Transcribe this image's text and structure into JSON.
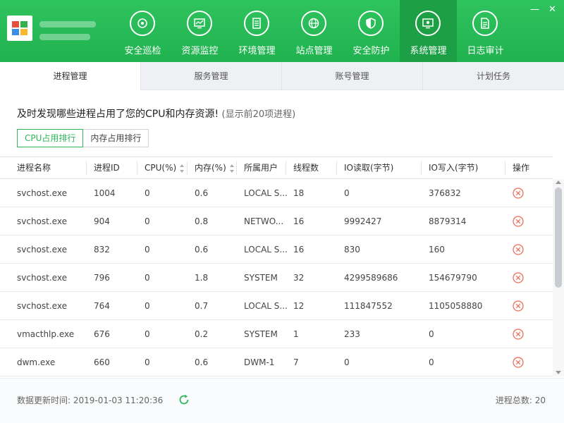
{
  "header": {
    "nav": [
      {
        "label": "安全巡检",
        "icon": "shield-scan-icon"
      },
      {
        "label": "资源监控",
        "icon": "monitor-chart-icon"
      },
      {
        "label": "环境管理",
        "icon": "server-icon"
      },
      {
        "label": "站点管理",
        "icon": "globe-icon"
      },
      {
        "label": "安全防护",
        "icon": "shield-icon"
      },
      {
        "label": "系统管理",
        "icon": "system-monitor-icon"
      },
      {
        "label": "日志审计",
        "icon": "document-icon"
      }
    ],
    "active_nav": "系统管理",
    "minimize": "—",
    "close": "✕"
  },
  "tabs": [
    "进程管理",
    "服务管理",
    "账号管理",
    "计划任务"
  ],
  "active_tab": "进程管理",
  "intro": {
    "main": "及时发现哪些进程占用了您的CPU和内存资源!",
    "note": "(显示前20项进程)"
  },
  "sort_buttons": [
    "CPU占用排行",
    "内存占用排行"
  ],
  "table": {
    "columns": [
      "进程名称",
      "进程ID",
      "CPU(%)",
      "内存(%)",
      "所属用户",
      "线程数",
      "IO读取(字节)",
      "IO写入(字节)",
      "操作"
    ],
    "rows": [
      {
        "name": "svchost.exe",
        "pid": "1004",
        "cpu": "0",
        "mem": "0.6",
        "user": "LOCAL S...",
        "threads": "18",
        "io_read": "0",
        "io_write": "376832"
      },
      {
        "name": "svchost.exe",
        "pid": "904",
        "cpu": "0",
        "mem": "0.8",
        "user": "NETWO...",
        "threads": "16",
        "io_read": "9992427",
        "io_write": "8879314"
      },
      {
        "name": "svchost.exe",
        "pid": "832",
        "cpu": "0",
        "mem": "0.6",
        "user": "LOCAL S...",
        "threads": "16",
        "io_read": "830",
        "io_write": "160"
      },
      {
        "name": "svchost.exe",
        "pid": "796",
        "cpu": "0",
        "mem": "1.8",
        "user": "SYSTEM",
        "threads": "32",
        "io_read": "4299589686",
        "io_write": "154679790"
      },
      {
        "name": "svchost.exe",
        "pid": "764",
        "cpu": "0",
        "mem": "0.7",
        "user": "LOCAL S...",
        "threads": "12",
        "io_read": "111847552",
        "io_write": "1105058880"
      },
      {
        "name": "vmacthlp.exe",
        "pid": "676",
        "cpu": "0",
        "mem": "0.2",
        "user": "SYSTEM",
        "threads": "1",
        "io_read": "233",
        "io_write": "0"
      },
      {
        "name": "dwm.exe",
        "pid": "660",
        "cpu": "0",
        "mem": "0.6",
        "user": "DWM-1",
        "threads": "7",
        "io_read": "0",
        "io_write": "0"
      }
    ]
  },
  "footer": {
    "update_time": "数据更新时间: 2019-01-03 11:20:36",
    "total": "进程总数: 20"
  },
  "colors": {
    "brand": "#20b24f",
    "active_nav": "#1d9f45",
    "delete": "#f06c5a"
  }
}
